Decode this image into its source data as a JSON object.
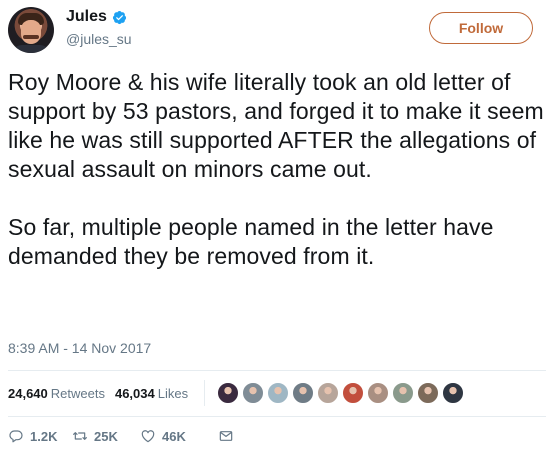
{
  "author": {
    "display_name": "Jules",
    "handle": "@jules_su",
    "verified_icon": "verified-badge-icon",
    "verified_color": "#1da1f2"
  },
  "follow_button": {
    "label": "Follow",
    "color": "#c06a3a"
  },
  "tweet": {
    "paragraphs": [
      "Roy Moore & his wife literally took an old letter of support by 53 pastors, and forged it to make it seem like he was still supported AFTER the allegations of sexual assault on minors came out.",
      "So far, multiple people named in the letter have demanded they be removed from it."
    ],
    "timestamp": "8:39 AM - 14 Nov 2017"
  },
  "stats": {
    "retweets_count": "24,640",
    "retweets_label": "Retweets",
    "likes_count": "46,034",
    "likes_label": "Likes"
  },
  "liker_avatars": [
    {
      "name": "liker-avatar-1",
      "color": "#3a2a3f"
    },
    {
      "name": "liker-avatar-2",
      "color": "#7f8c96"
    },
    {
      "name": "liker-avatar-3",
      "color": "#9fb7c4"
    },
    {
      "name": "liker-avatar-4",
      "color": "#6f7c86"
    },
    {
      "name": "liker-avatar-5",
      "color": "#b7a59a"
    },
    {
      "name": "liker-avatar-6",
      "color": "#c24f3d"
    },
    {
      "name": "liker-avatar-7",
      "color": "#a98f82"
    },
    {
      "name": "liker-avatar-8",
      "color": "#8a9a8c"
    },
    {
      "name": "liker-avatar-9",
      "color": "#7c6a5a"
    },
    {
      "name": "liker-avatar-10",
      "color": "#2e3642"
    }
  ],
  "actions": {
    "reply": {
      "icon": "reply-icon",
      "count": "1.2K"
    },
    "retweet": {
      "icon": "retweet-icon",
      "count": "25K"
    },
    "like": {
      "icon": "heart-icon",
      "count": "46K"
    },
    "message": {
      "icon": "direct-message-icon"
    }
  },
  "colors": {
    "text": "#14171a",
    "secondary_text": "#657786",
    "divider": "#e6ecf0"
  }
}
